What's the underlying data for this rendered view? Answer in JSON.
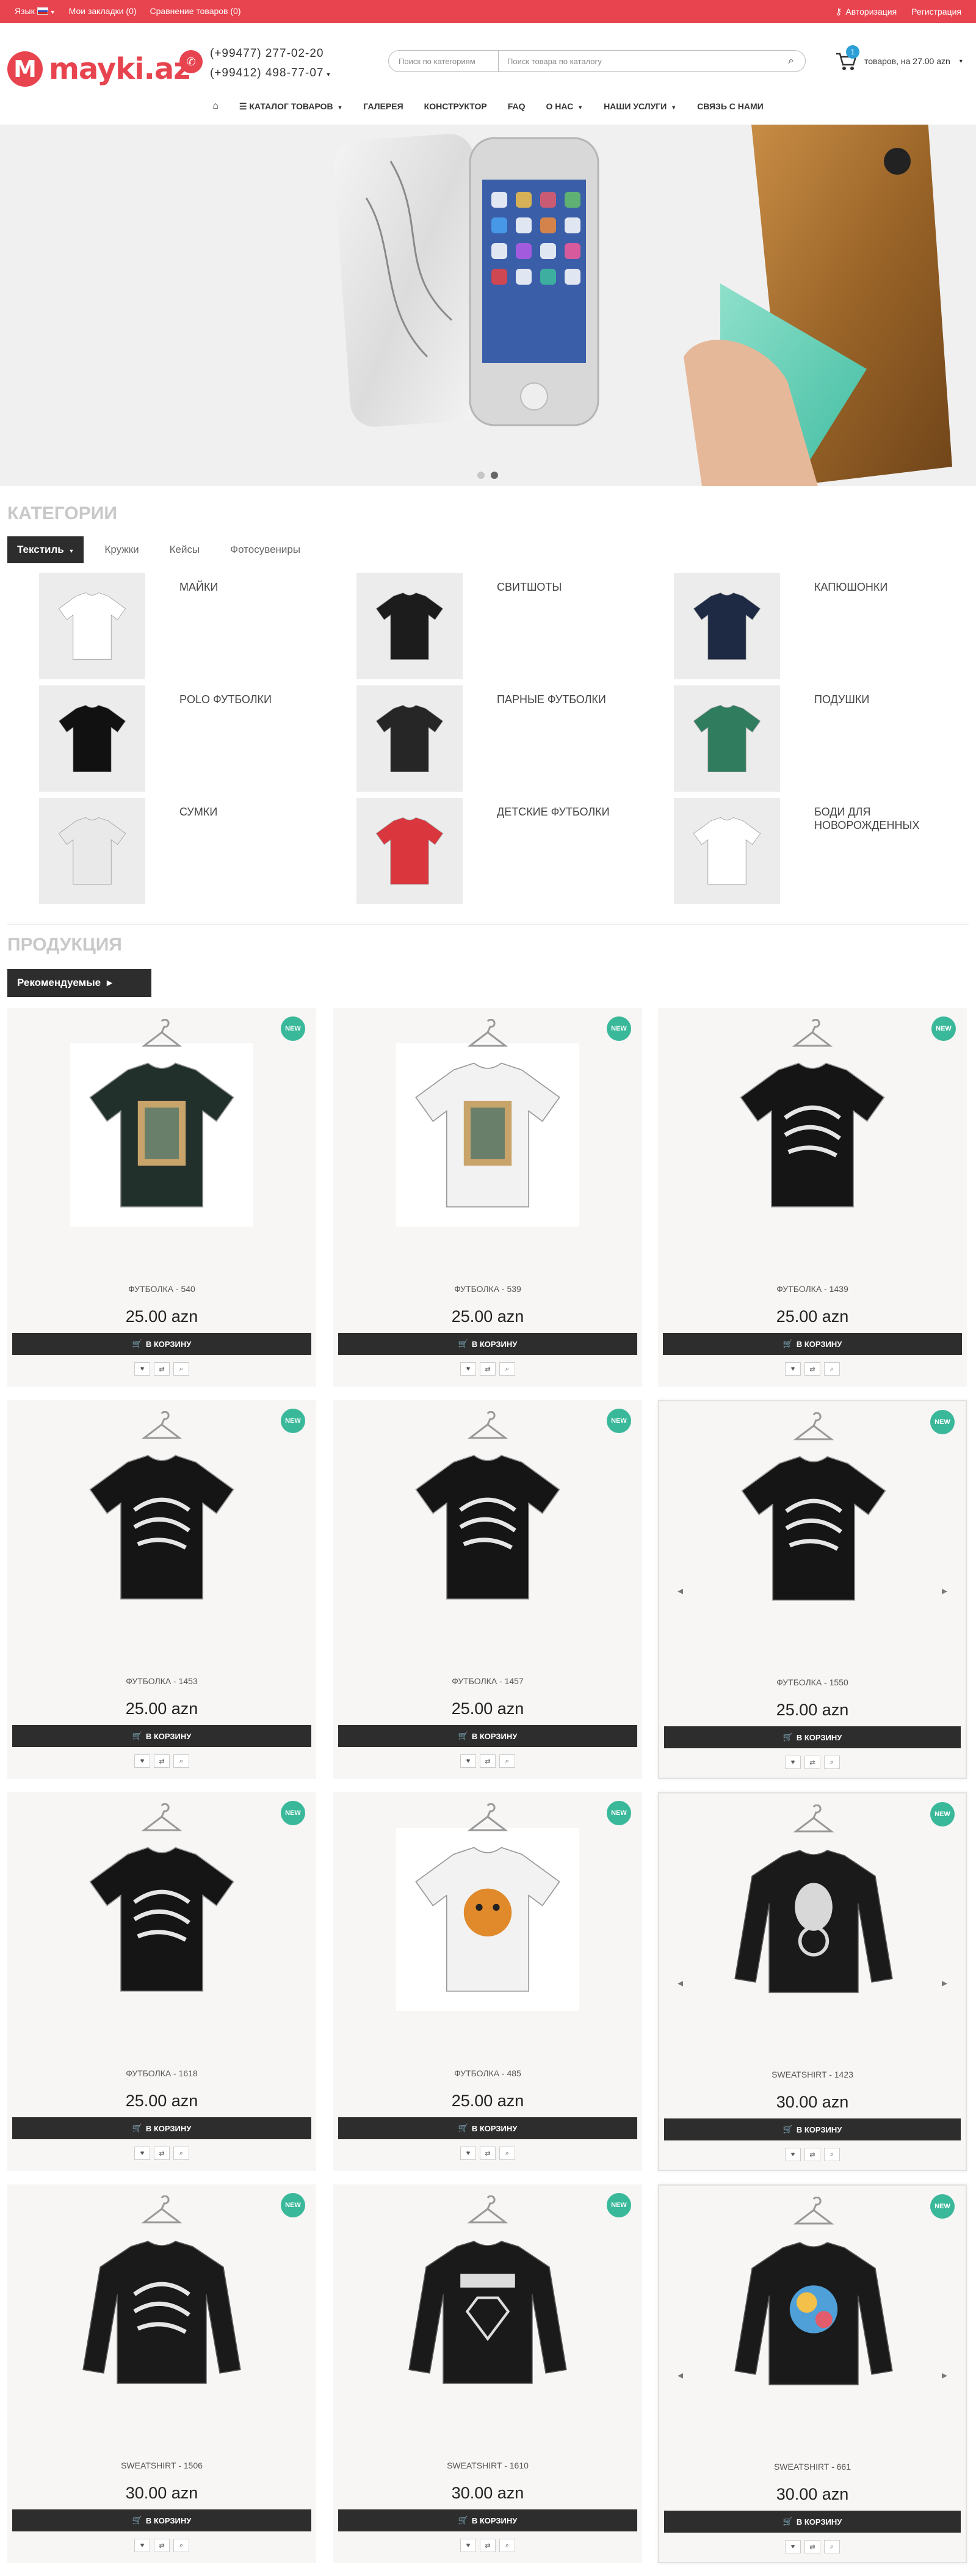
{
  "topbar": {
    "language": "Язык",
    "bookmarks": "Мои закладки (0)",
    "compare": "Сравнение товаров (0)",
    "login": "Авторизация",
    "register": "Регистрация"
  },
  "header": {
    "logo_mark": "M",
    "logo_text": "mayki.az",
    "phone1": "(+99477) 277-02-20",
    "phone2": "(+99412) 498-77-07",
    "search_category_placeholder": "Поиск по категориям",
    "search_placeholder": "Поиск товара по каталогу",
    "cart_count": "1",
    "cart_text": "товаров, на 27.00 azn"
  },
  "nav": {
    "items": [
      "КАТАЛОГ ТОВАРОВ",
      "ГАЛЕРЕЯ",
      "КОНСТРУКТОР",
      "FAQ",
      "О НАС",
      "НАШИ УСЛУГИ",
      "СВЯЗЬ С НАМИ"
    ]
  },
  "categories": {
    "title": "КАТЕГОРИИ",
    "tabs": [
      "Текстиль",
      "Кружки",
      "Кейсы",
      "Фотосувениры"
    ],
    "items": [
      {
        "label": "МАЙКИ",
        "color": "#ffffff"
      },
      {
        "label": "СВИТШОТЫ",
        "color": "#1c1c1c"
      },
      {
        "label": "КАПЮШОНКИ",
        "color": "#1e2a44"
      },
      {
        "label": "POLO ФУТБОЛКИ",
        "color": "#111111"
      },
      {
        "label": "ПАРНЫЕ ФУТБОЛКИ",
        "color": "#262626"
      },
      {
        "label": "ПОДУШКИ",
        "color": "#2f7d5e"
      },
      {
        "label": "СУМКИ",
        "color": "#e9e9e9"
      },
      {
        "label": "ДЕТСКИЕ ФУТБОЛКИ",
        "color": "#d9373d"
      },
      {
        "label": "БОДИ ДЛЯ НОВОРОЖДЕННЫХ",
        "color": "#ffffff"
      }
    ]
  },
  "products": {
    "title": "ПРОДУКЦИЯ",
    "filter_label": "Рекомендуемые",
    "badge": "NEW",
    "add_label": "В КОРЗИНУ",
    "items": [
      {
        "name": "ФУТБОЛКА - 540",
        "price": "25.00 azn",
        "kind": "tee",
        "color": "#22302c",
        "print": "photo"
      },
      {
        "name": "ФУТБОЛКА - 539",
        "price": "25.00 azn",
        "kind": "tee",
        "color": "#f2f2f2",
        "print": "photo"
      },
      {
        "name": "ФУТБОЛКА - 1439",
        "price": "25.00 azn",
        "kind": "tee",
        "color": "#151515",
        "print": "script"
      },
      {
        "name": "ФУТБОЛКА - 1453",
        "price": "25.00 azn",
        "kind": "tee",
        "color": "#151515",
        "print": "script"
      },
      {
        "name": "ФУТБОЛКА - 1457",
        "price": "25.00 azn",
        "kind": "tee",
        "color": "#151515",
        "print": "script"
      },
      {
        "name": "ФУТБОЛКА - 1550",
        "price": "25.00 azn",
        "kind": "tee",
        "color": "#151515",
        "print": "script"
      },
      {
        "name": "ФУТБОЛКА - 1618",
        "price": "25.00 azn",
        "kind": "tee",
        "color": "#151515",
        "print": "script"
      },
      {
        "name": "ФУТБОЛКА - 485",
        "price": "25.00 azn",
        "kind": "tee",
        "color": "#f2f2f2",
        "print": "tiger"
      },
      {
        "name": "SWEATSHIRT - 1423",
        "price": "30.00 azn",
        "kind": "sweat",
        "color": "#1a1a1a",
        "print": "alien"
      },
      {
        "name": "SWEATSHIRT - 1506",
        "price": "30.00 azn",
        "kind": "sweat",
        "color": "#1a1a1a",
        "print": "script"
      },
      {
        "name": "SWEATSHIRT - 1610",
        "price": "30.00 azn",
        "kind": "sweat",
        "color": "#1a1a1a",
        "print": "diamond"
      },
      {
        "name": "SWEATSHIRT - 661",
        "price": "30.00 azn",
        "kind": "sweat",
        "color": "#1a1a1a",
        "print": "colorful"
      }
    ]
  }
}
